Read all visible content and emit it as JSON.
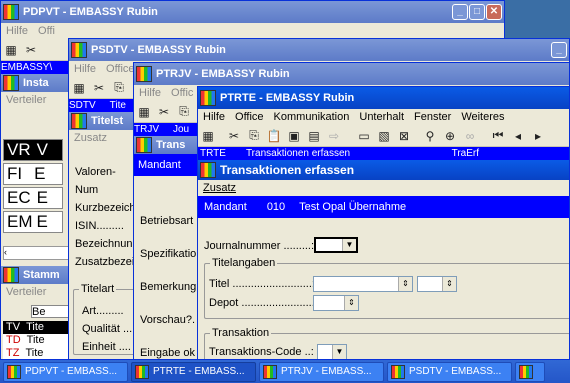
{
  "windows": {
    "pdpvt": {
      "title": "PDPVT - EMBASSY Rubin",
      "menu": [
        "Hilfe",
        "Offi"
      ],
      "strip": "EMBASSY\\",
      "sub_title": "Insta",
      "sub_menu": [
        "Verteiler"
      ],
      "codes": [
        "VR",
        "FI",
        "EC",
        "EM"
      ],
      "codes_suffix": [
        "V",
        "E",
        "E",
        "E"
      ],
      "stamm_title": "Stamm",
      "stamm_menu": "Verteiler",
      "stamm_strip": "Be",
      "stamm_codes": [
        "TV",
        "TD",
        "TZ"
      ],
      "stamm_suffix": [
        "Tite",
        "Tite",
        "Tite"
      ]
    },
    "psdtv": {
      "title": "PSDTV - EMBASSY Rubin",
      "menu": [
        "Hilfe",
        "Office"
      ],
      "strip_left": "SDTV",
      "strip_right": "Tite",
      "sub_title": "Titelst",
      "zusatz": "Zusatz",
      "labels": [
        "Valoren-Num",
        "Kurzbezeich",
        "ISIN.........",
        "Bezeichnung",
        "Zusatzbezei"
      ],
      "group_title": "Titelart",
      "group_labels": [
        "Art.........",
        "Qualität ...",
        "Einheit ...."
      ]
    },
    "ptrjv": {
      "title": "PTRJV - EMBASSY Rubin",
      "menu": [
        "Hilfe",
        "Offic"
      ],
      "strip_left": "TRJV",
      "strip_right": "Jou",
      "sub_title": "Trans",
      "mandant": "Mandant",
      "labels": [
        "Betriebsart .",
        "Spezifikatio",
        "Bemerkung",
        "Vorschau?.",
        "Eingabe ok"
      ]
    },
    "ptrte": {
      "title": "PTRTE - EMBASSY Rubin",
      "menu": [
        "Hilfe",
        "Office",
        "Kommunikation",
        "Unterhalt",
        "Fenster",
        "Weiteres"
      ],
      "strip_left": "TRTE",
      "strip_mid": "Transaktionen erfassen",
      "strip_right": "TraErf",
      "sub_title": "Transaktionen erfassen",
      "zusatz": "Zusatz",
      "mandant_label": "Mandant",
      "mandant_nr": "010",
      "mandant_name": "Test Opal Übernahme",
      "journal_label": "Journalnummer .........:",
      "titelangaben": "Titelangaben",
      "titel_label": "Titel ..........................:",
      "depot_label": "Depot ........................:",
      "transaktion": "Transaktion",
      "tcode_label": "Transaktions-Code ..:"
    }
  },
  "taskbar": [
    {
      "label": "PDPVT - EMBASS...",
      "active": false
    },
    {
      "label": "PTRTE - EMBASS...",
      "active": true
    },
    {
      "label": "PTRJV - EMBASS...",
      "active": false
    },
    {
      "label": "PSDTV - EMBASS...",
      "active": false
    }
  ],
  "colors": {
    "desktop": "#3a6ea5",
    "title_active": "#0842c4",
    "title_inactive": "#7b97d6",
    "strip": "#0000ff"
  }
}
